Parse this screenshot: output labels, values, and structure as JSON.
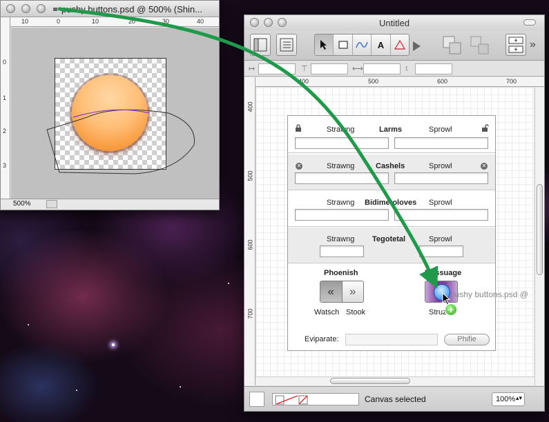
{
  "photoshop_window": {
    "title": "pushy buttons.psd @ 500% (Shin...",
    "ruler_h_ticks": [
      "10",
      "0",
      "10",
      "20",
      "30",
      "40"
    ],
    "ruler_v_ticks": [
      "0",
      "1",
      "2",
      "3"
    ],
    "zoom": "500%"
  },
  "designer_window": {
    "title": "Untitled",
    "toolbar": {
      "text_tool_glyph": "A",
      "overflow": "»"
    },
    "ruler_h_ticks": [
      "400",
      "500",
      "600",
      "700"
    ],
    "ruler_v_ticks": [
      "400",
      "500",
      "600",
      "700"
    ],
    "status_text": "Canvas selected",
    "zoom_value": "100%"
  },
  "form": {
    "rows": [
      {
        "left": "Strawng",
        "center": "Larms",
        "right": "Sprowl"
      },
      {
        "left": "Strawng",
        "center": "Cashels",
        "right": "Sprowl"
      },
      {
        "left": "Strawng",
        "center": "Bidimetoloves",
        "right": "Sprowl"
      },
      {
        "left": "Strawng",
        "center": "Tegotetal",
        "right": "Sprowl"
      }
    ],
    "bottom": {
      "left_heading": "Phoenish",
      "left_seg": [
        "«",
        "»"
      ],
      "left_caption_a": "Watsch",
      "left_caption_b": "Stook",
      "right_heading": "Messuage",
      "right_caption": "Struz",
      "field_label": "Eviparate:",
      "button_label": "Phifie"
    }
  },
  "drag_ghost_text": "pushy buttons.psd @",
  "accent_colors": {
    "arrow": "#1f9a4a",
    "orb_orange": "#f8983a",
    "button_purple": "#7b3ea0",
    "orb_blue": "#6ab0ff"
  }
}
